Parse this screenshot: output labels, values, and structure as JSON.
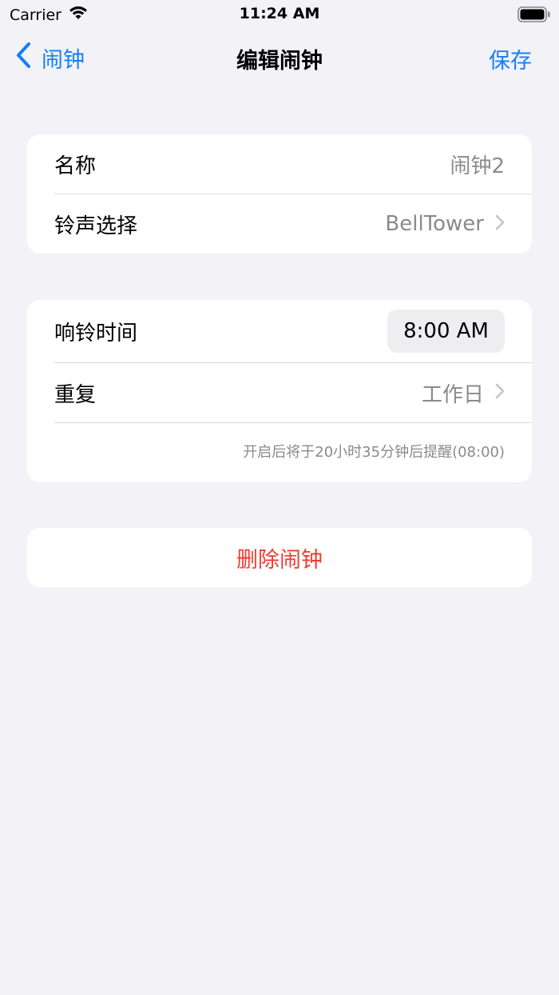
{
  "status_bar": {
    "carrier": "Carrier",
    "time": "11:24 AM"
  },
  "nav": {
    "back_label": "闹钟",
    "title": "编辑闹钟",
    "save_label": "保存"
  },
  "section1": {
    "name_label": "名称",
    "name_value": "闹钟2",
    "ringtone_label": "铃声选择",
    "ringtone_value": "BellTower"
  },
  "section2": {
    "time_label": "响铃时间",
    "time_value": "8:00 AM",
    "repeat_label": "重复",
    "repeat_value": "工作日",
    "hint": "开启后将于20小时35分钟后提醒(08:00)"
  },
  "delete": {
    "label": "删除闹钟"
  },
  "colors": {
    "accent": "#157efb",
    "destructive": "#f23a2f",
    "background": "#f2f2f7",
    "secondary_text": "#8a8a8e"
  },
  "icons": {
    "back": "chevron-left-icon",
    "disclosure": "chevron-right-icon",
    "wifi": "wifi-icon",
    "battery": "battery-icon"
  }
}
